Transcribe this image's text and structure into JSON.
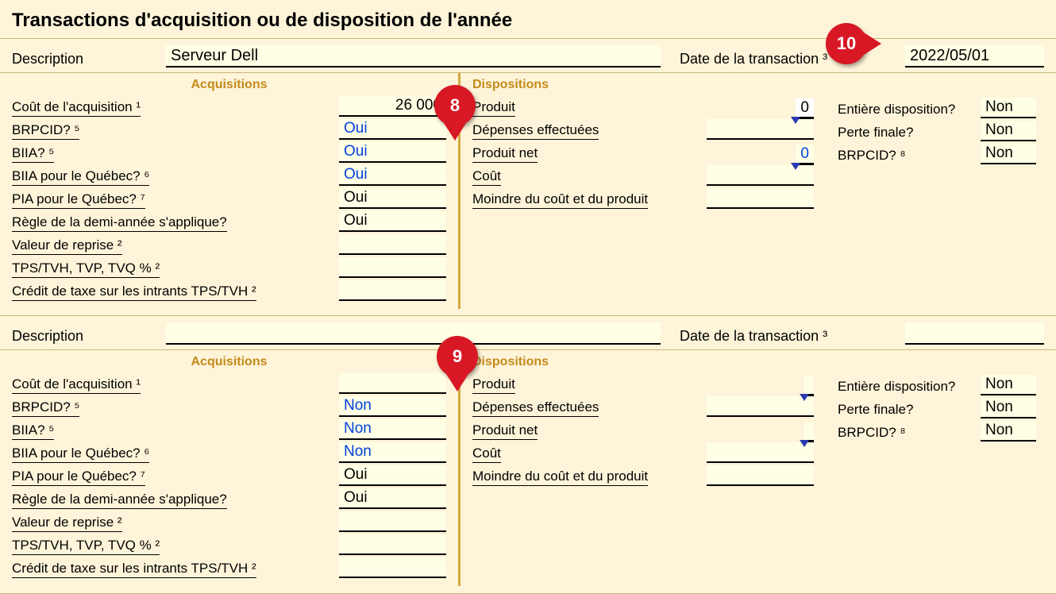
{
  "title": "Transactions d'acquisition ou de disposition de l'année",
  "labels": {
    "description": "Description",
    "date": "Date de la transaction ³",
    "acq_heading": "Acquisitions",
    "disp_heading": "Dispositions",
    "cout_acq": "Coût de l'acquisition ¹",
    "brpcid5": "BRPCID? ⁵",
    "biia5": "BIIA? ⁵",
    "biia_qc": "BIIA pour le Québec? ⁶",
    "pia_qc": "PIA pour le Québec? ⁷",
    "demi_annee": "Règle de la demi-année s'applique?",
    "valeur_reprise": "Valeur de reprise ²",
    "tps_pct": "TPS/TVH, TVP, TVQ % ²",
    "credit_taxe": "Crédit de taxe sur les intrants TPS/TVH ²",
    "produit": "Produit",
    "depenses": "Dépenses effectuées",
    "produit_net": "Produit net",
    "cout": "Coût",
    "moindre": "Moindre du coût et du produit",
    "entiere_disp": "Entière disposition?",
    "perte_finale": "Perte finale?",
    "brpcid8": "BRPCID? ⁸"
  },
  "callouts": {
    "a": "8",
    "b": "9",
    "c": "10"
  },
  "transactions": [
    {
      "description": "Serveur Dell",
      "date": "2022/05/01",
      "acq": {
        "cout": "26 000",
        "brpcid": "Oui",
        "biia": "Oui",
        "biia_qc": "Oui",
        "pia_qc": "Oui",
        "demi_annee": "Oui",
        "valeur_reprise": "",
        "tps_pct": "",
        "credit_taxe": ""
      },
      "disp": {
        "produit": "0",
        "depenses": "",
        "produit_net": "0",
        "cout": "",
        "moindre": "",
        "entiere": "Non",
        "perte": "Non",
        "brpcid": "Non"
      }
    },
    {
      "description": "",
      "date": "",
      "acq": {
        "cout": "",
        "brpcid": "Non",
        "biia": "Non",
        "biia_qc": "Non",
        "pia_qc": "Oui",
        "demi_annee": "Oui",
        "valeur_reprise": "",
        "tps_pct": "",
        "credit_taxe": ""
      },
      "disp": {
        "produit": "",
        "depenses": "",
        "produit_net": "",
        "cout": "",
        "moindre": "",
        "entiere": "Non",
        "perte": "Non",
        "brpcid": "Non"
      }
    }
  ]
}
